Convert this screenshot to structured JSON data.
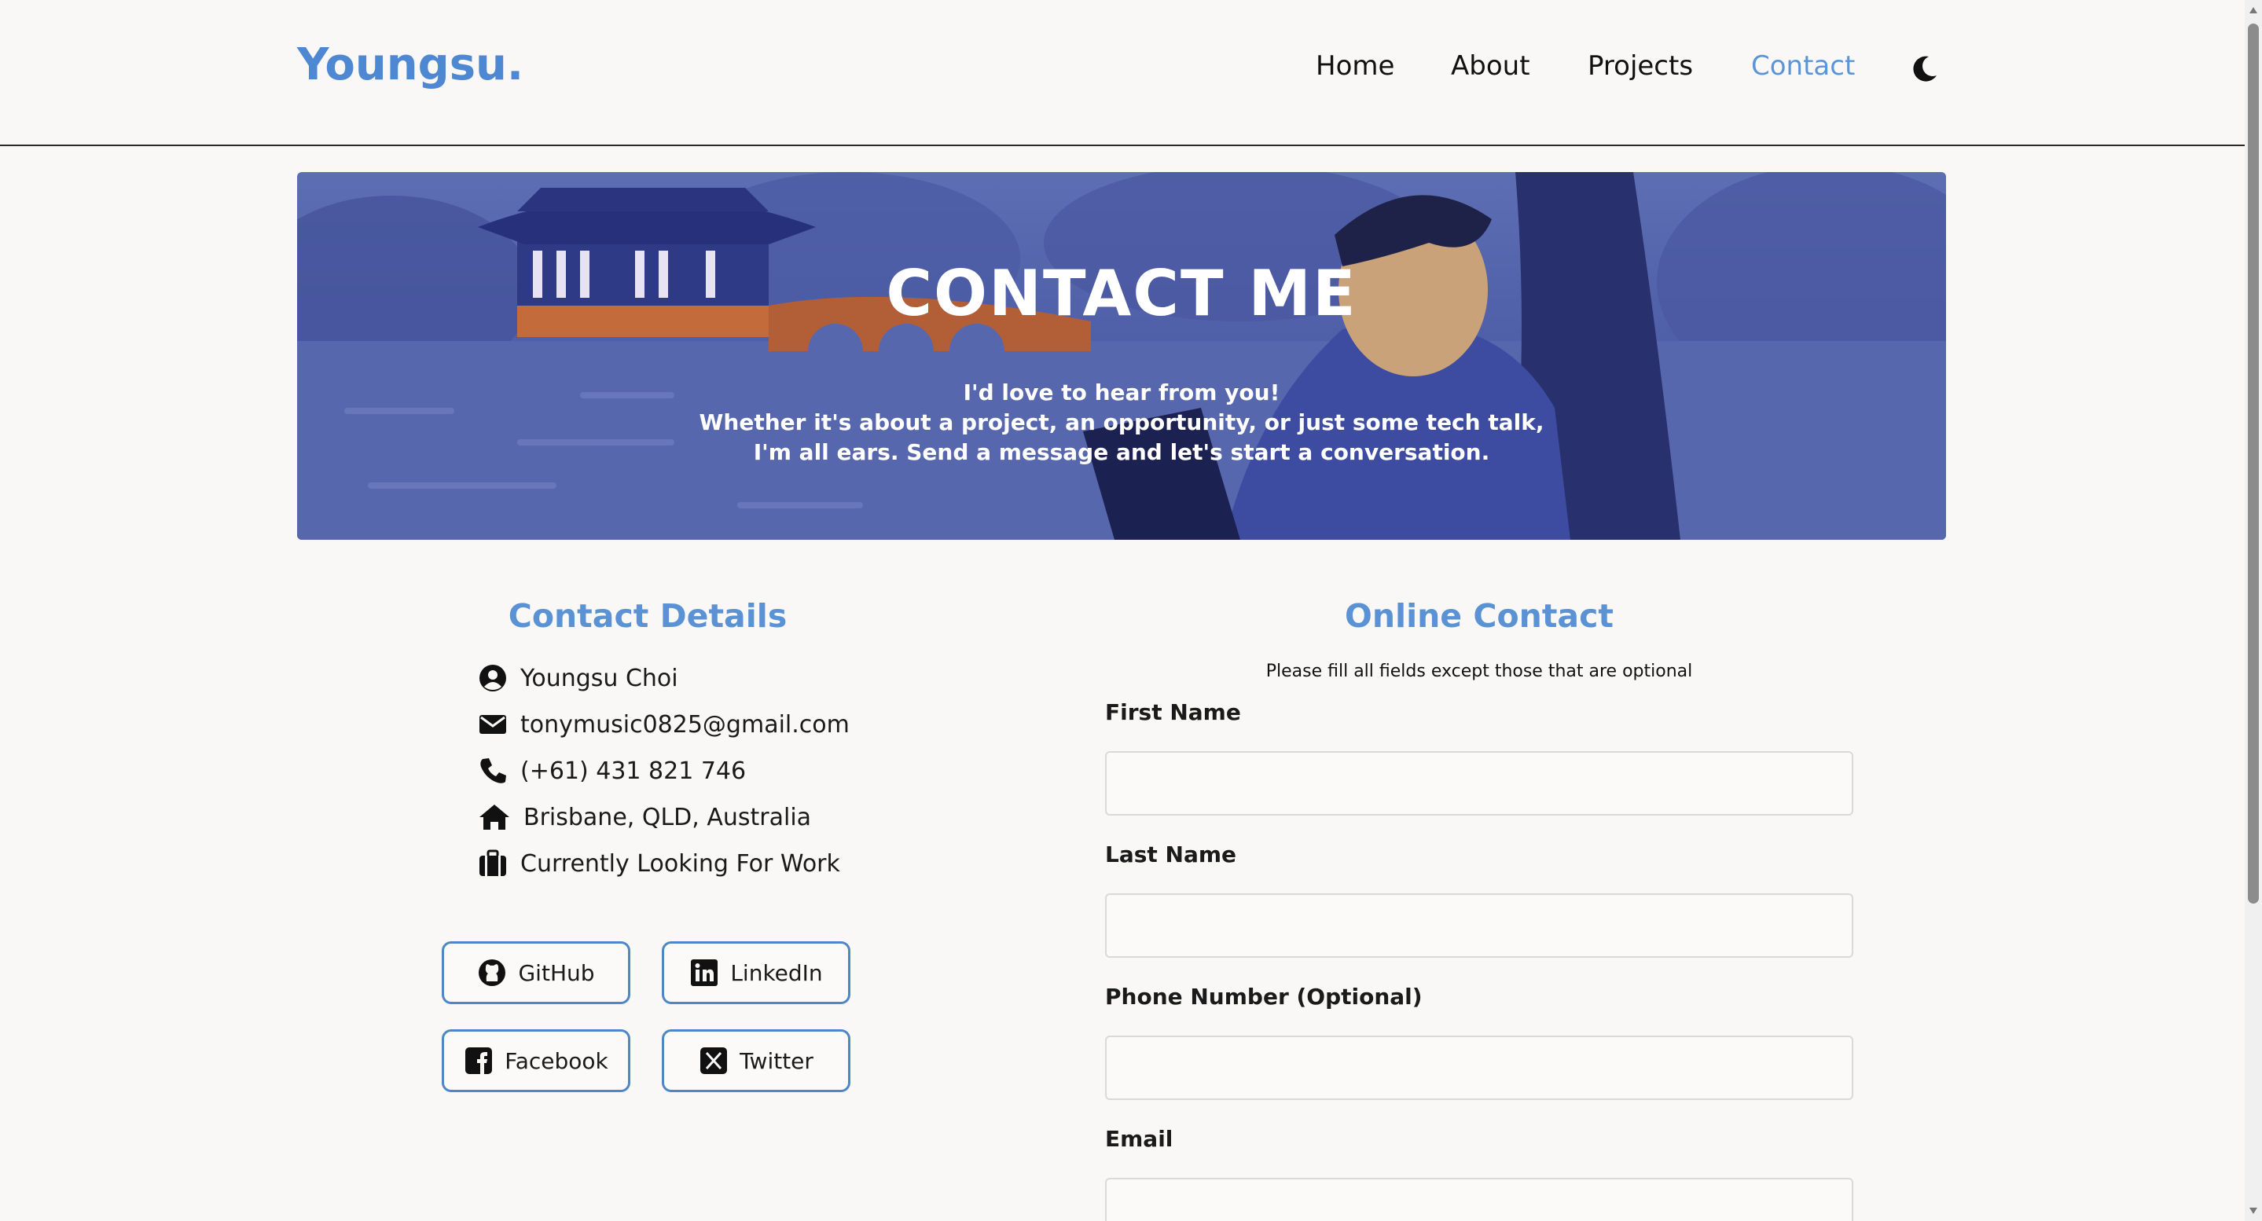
{
  "brand": {
    "logo": "Youngsu.",
    "accent_color": "#4e88d2"
  },
  "nav": {
    "items": [
      "Home",
      "About",
      "Projects",
      "Contact"
    ],
    "active": "Contact",
    "theme_toggle_icon": "moon-icon"
  },
  "banner": {
    "title": "CONTACT ME",
    "lines": [
      "I'd love to hear from you!",
      "Whether it's about a project, an opportunity, or just some tech talk,",
      "I'm all ears. Send a message and let's start a conversation."
    ]
  },
  "contact_details": {
    "title": "Contact Details",
    "items": [
      {
        "icon": "user-circle-icon",
        "text": "Youngsu Choi"
      },
      {
        "icon": "envelope-icon",
        "text": "tonymusic0825@gmail.com"
      },
      {
        "icon": "phone-icon",
        "text": "(+61) 431 821 746"
      },
      {
        "icon": "home-icon",
        "text": "Brisbane, QLD, Australia"
      },
      {
        "icon": "briefcase-icon",
        "text": "Currently Looking For Work"
      }
    ]
  },
  "social": [
    {
      "icon": "github-icon",
      "label": "GitHub"
    },
    {
      "icon": "linkedin-icon",
      "label": "LinkedIn"
    },
    {
      "icon": "facebook-icon",
      "label": "Facebook"
    },
    {
      "icon": "x-twitter-icon",
      "label": "Twitter"
    }
  ],
  "online_contact": {
    "title": "Online Contact",
    "note": "Please fill all fields except those that are optional",
    "fields": [
      {
        "label": "First Name",
        "value": ""
      },
      {
        "label": "Last Name",
        "value": ""
      },
      {
        "label": "Phone Number (Optional)",
        "value": ""
      },
      {
        "label": "Email",
        "value": ""
      }
    ]
  }
}
